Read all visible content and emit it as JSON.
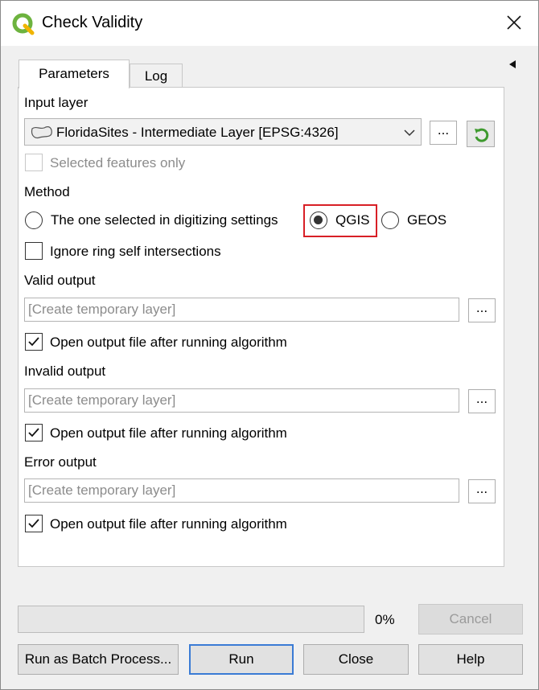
{
  "window": {
    "title": "Check Validity",
    "icon": "qgis-logo-icon",
    "close_icon": "close-icon"
  },
  "tabs": [
    {
      "label": "Parameters",
      "active": true
    },
    {
      "label": "Log",
      "active": false
    }
  ],
  "params": {
    "input_layer_label": "Input layer",
    "input_layer_value": "FloridaSites - Intermediate Layer [EPSG:4326]",
    "browse_label": "...",
    "selected_only_label": "Selected features only",
    "method_label": "Method",
    "method_options": [
      {
        "label": "The one selected in digitizing settings",
        "selected": false
      },
      {
        "label": "QGIS",
        "selected": true
      },
      {
        "label": "GEOS",
        "selected": false
      }
    ],
    "ignore_ring_label": "Ignore ring self intersections",
    "outputs": [
      {
        "label": "Valid output",
        "placeholder": "[Create temporary layer]",
        "open_label": "Open output file after running algorithm",
        "open_checked": true
      },
      {
        "label": "Invalid output",
        "placeholder": "[Create temporary layer]",
        "open_label": "Open output file after running algorithm",
        "open_checked": true
      },
      {
        "label": "Error output",
        "placeholder": "[Create temporary layer]",
        "open_label": "Open output file after running algorithm",
        "open_checked": true
      }
    ]
  },
  "footer": {
    "progress": 0,
    "progress_text": "0%",
    "cancel_label": "Cancel",
    "batch_label": "Run as Batch Process...",
    "run_label": "Run",
    "close_label": "Close",
    "help_label": "Help"
  },
  "colors": {
    "highlight": "#d81f26",
    "default_button_border": "#3a7bd5",
    "qgis_green": "#6db33f"
  }
}
